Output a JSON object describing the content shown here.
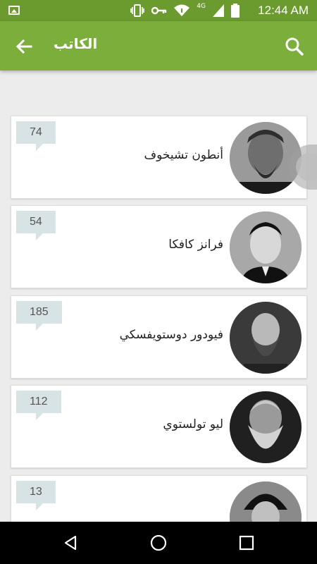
{
  "status_bar": {
    "time": "12:44 AM",
    "network": "4G",
    "icons": [
      "image-icon",
      "vibrate-icon",
      "key-icon",
      "wifi-icon",
      "signal-icon",
      "battery-icon"
    ]
  },
  "app_bar": {
    "title": "الكاتب",
    "back_icon": "arrow-back-icon",
    "search_icon": "search-icon",
    "color": "#7cae3c"
  },
  "authors": [
    {
      "name": "أنطون تشيخوف",
      "count": "74"
    },
    {
      "name": "فرانز كافكا",
      "count": "54"
    },
    {
      "name": "فيودور دوستويفسكي",
      "count": "185"
    },
    {
      "name": "ليو تولستوي",
      "count": "112"
    },
    {
      "name": "",
      "count": "13"
    }
  ],
  "nav_bar": {
    "icons": [
      "back-triangle-icon",
      "home-circle-icon",
      "recent-square-icon"
    ]
  }
}
